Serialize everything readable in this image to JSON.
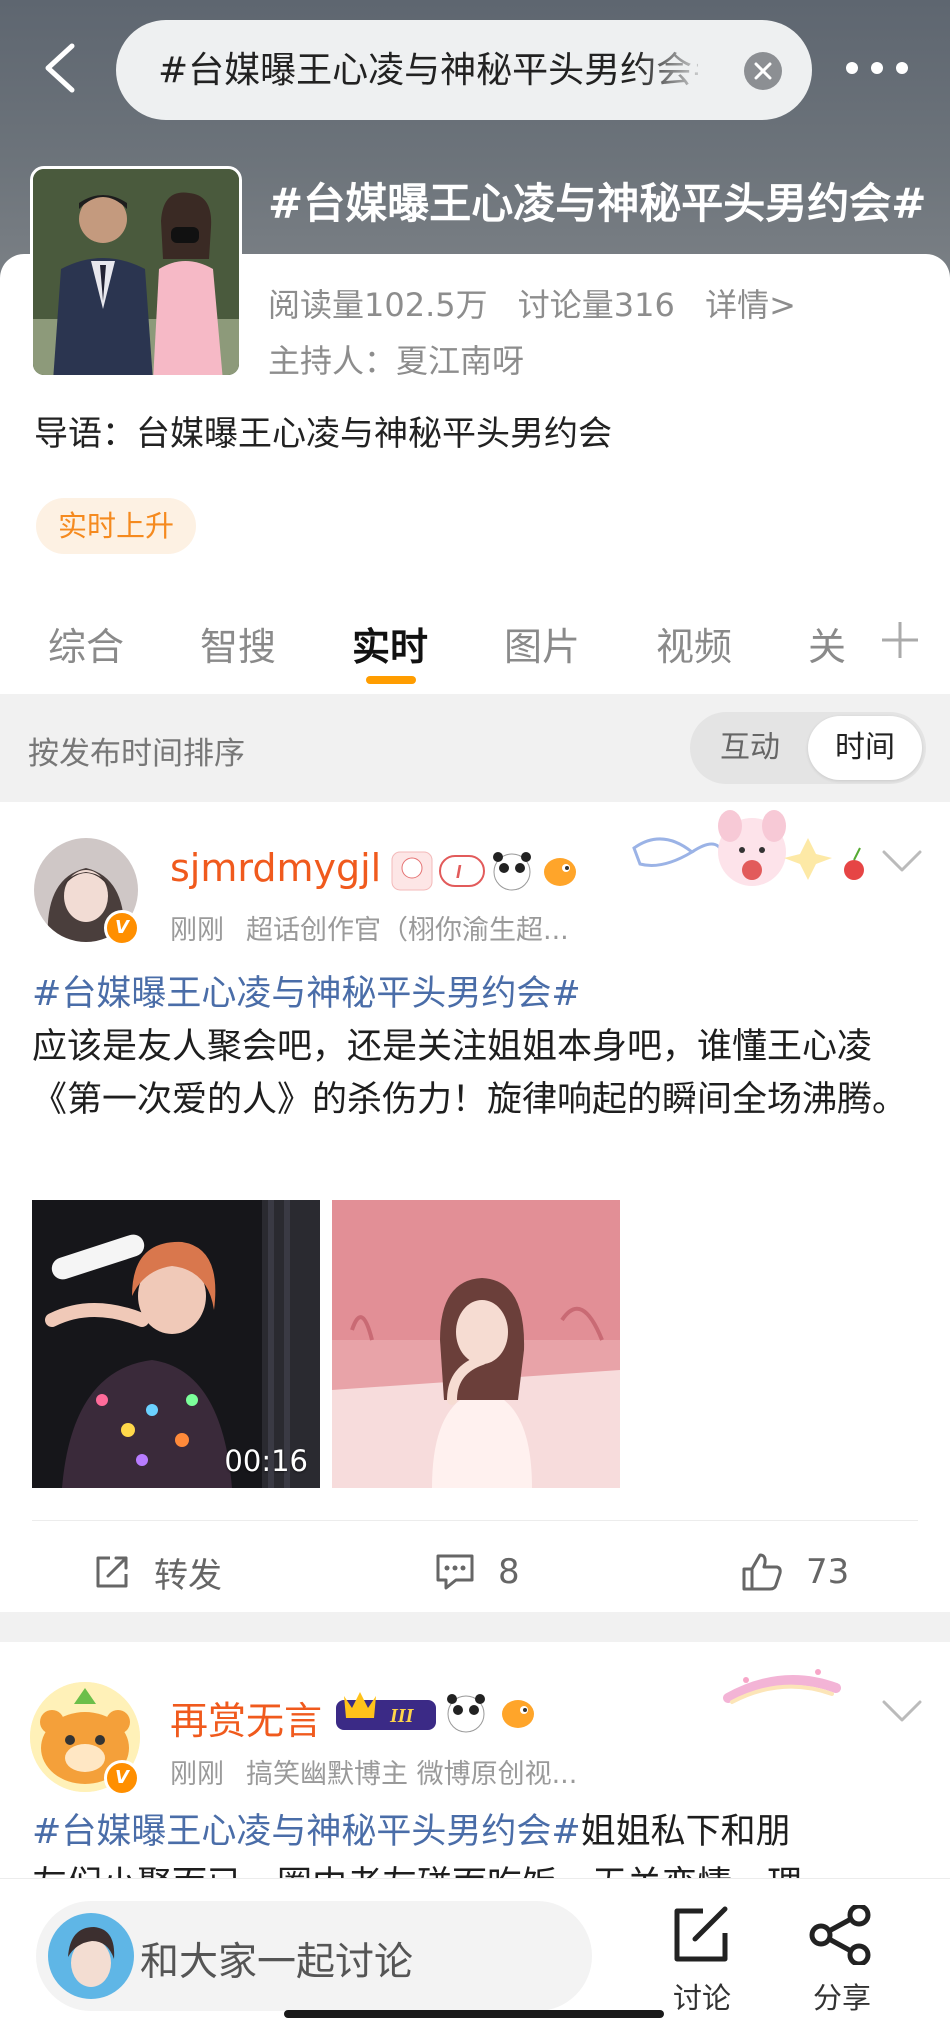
{
  "header": {
    "search_value": "#台媒曝王心凌与神秘平头男约会#",
    "topic_title": "#台媒曝王心凌与神秘平头男约会#"
  },
  "topic": {
    "reads": "阅读量102.5万",
    "discussions": "讨论量316",
    "details_link": "详情>",
    "host": "主持人：夏江南呀",
    "lead": "导语：台媒曝王心凌与神秘平头男约会",
    "badge": "实时上升"
  },
  "tabs": [
    {
      "label": "综合"
    },
    {
      "label": "智搜"
    },
    {
      "label": "实时"
    },
    {
      "label": "图片"
    },
    {
      "label": "视频"
    },
    {
      "label": "关"
    }
  ],
  "sort": {
    "label": "按发布时间排序",
    "options": [
      "互动",
      "时间"
    ],
    "selected": "时间"
  },
  "posts": [
    {
      "username": "sjmrdmygjl",
      "time": "刚刚",
      "source": "超话创作官（栩你渝生超...",
      "topic_link": "#台媒曝王心凌与神秘平头男约会#",
      "text": "应该是友人聚会吧，还是关注姐姐本身吧，谁懂王心凌《第一次爱的人》的杀伤力！旋律响起的瞬间全场沸腾。",
      "video_duration": "00:16",
      "repost_label": "转发",
      "comments": "8",
      "likes": "73"
    },
    {
      "username": "再赏无言",
      "time": "刚刚",
      "source": "搞笑幽默博主 微博原创视...",
      "topic_link": "#台媒曝王心凌与神秘平头男约会#",
      "text_start": "姐姐私下和朋",
      "text_cut": "友们小聚而已，圈内老友碰面吃饭，无关恋情，理"
    }
  ],
  "bottom": {
    "comment_placeholder": "和大家一起讨论",
    "discuss_label": "讨论",
    "share_label": "分享"
  },
  "colors": {
    "accent_orange": "#ff9d00",
    "username_orange": "#f05a1d",
    "topic_link_blue": "#4a6da8"
  }
}
